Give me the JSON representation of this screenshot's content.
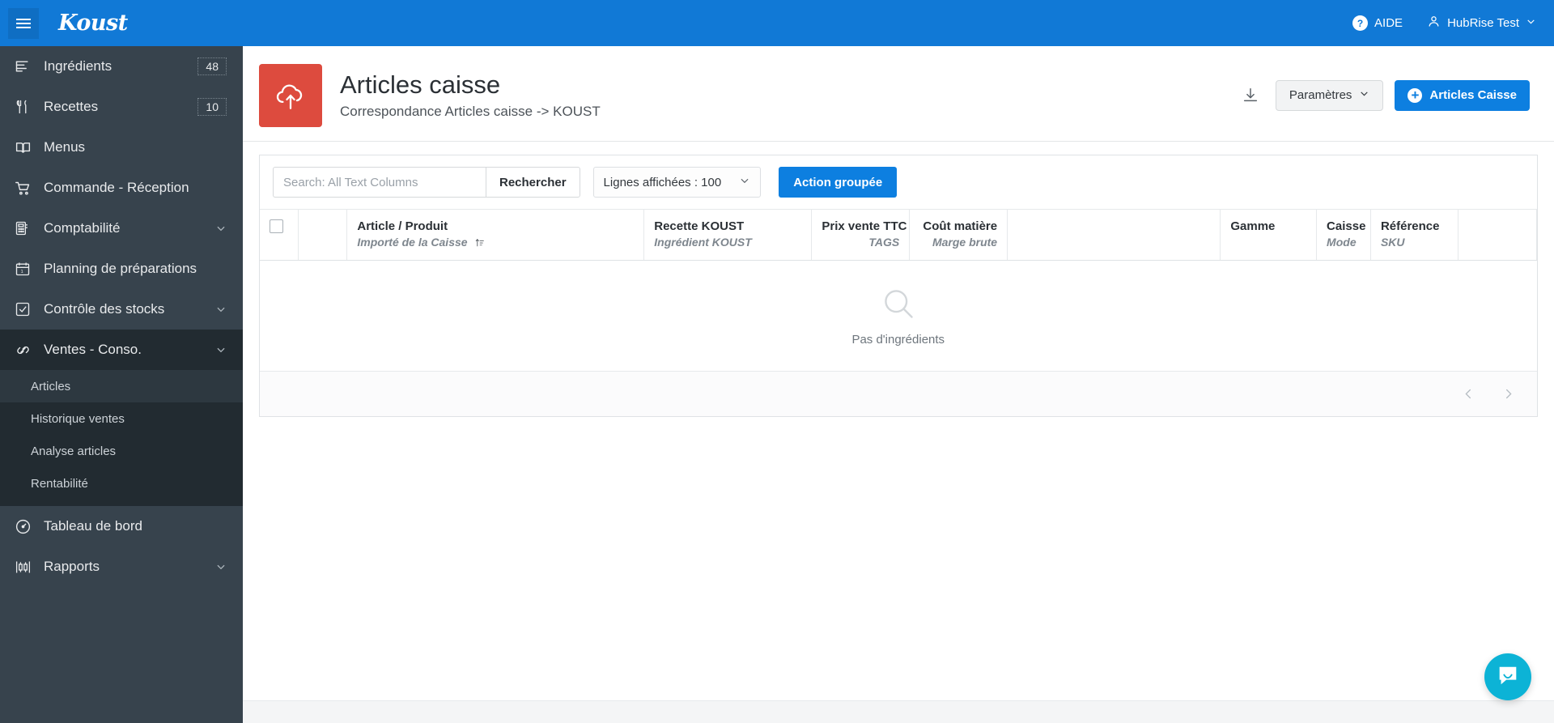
{
  "topbar": {
    "menu_icon": "hamburger-icon",
    "brand": "Koust",
    "help_label": "AIDE",
    "help_icon": "question-circle-icon",
    "user_label": "HubRise Test",
    "user_icon": "person-icon",
    "chevron_icon": "chevron-down-icon",
    "bg_color": "#1179d6"
  },
  "sidebar": {
    "bg_color": "#37434d",
    "items": [
      {
        "label": "Ingrédients",
        "icon": "list-lines-icon",
        "badge": "48",
        "chevron": false
      },
      {
        "label": "Recettes",
        "icon": "fork-knife-icon",
        "badge": "10",
        "chevron": false
      },
      {
        "label": "Menus",
        "icon": "open-book-icon",
        "badge": "",
        "chevron": false
      },
      {
        "label": "Commande - Réception",
        "icon": "shopping-cart-icon",
        "badge": "",
        "chevron": false
      },
      {
        "label": "Comptabilité",
        "icon": "calculator-icon",
        "badge": "",
        "chevron": true
      },
      {
        "label": "Planning de préparations",
        "icon": "calendar-icon",
        "badge": "",
        "chevron": false
      },
      {
        "label": "Contrôle des stocks",
        "icon": "checkbox-checked-icon",
        "badge": "",
        "chevron": true
      }
    ],
    "active_parent": {
      "label": "Ventes - Conso.",
      "icon": "link-chain-icon",
      "chevron": true
    },
    "subitems": [
      {
        "label": "Articles",
        "active": true
      },
      {
        "label": "Historique ventes",
        "active": false
      },
      {
        "label": "Analyse articles",
        "active": false
      },
      {
        "label": "Rentabilité",
        "active": false
      }
    ],
    "items_bottom": [
      {
        "label": "Tableau de bord",
        "icon": "gauge-icon",
        "badge": "",
        "chevron": false
      },
      {
        "label": "Rapports",
        "icon": "bar-chart-icon",
        "badge": "",
        "chevron": true
      }
    ]
  },
  "page": {
    "icon": "cloud-upload-icon",
    "icon_color": "#dd4b3e",
    "title": "Articles caisse",
    "subtitle": "Correspondance Articles caisse -> KOUST",
    "download_icon": "download-icon",
    "settings_label": "Paramètres",
    "settings_chevron": "chevron-down-icon",
    "primary_label": "Articles Caisse",
    "primary_icon": "plus-circle-icon",
    "primary_color": "#0d7fe0"
  },
  "toolbar": {
    "search_placeholder": "Search: All Text Columns",
    "search_value": "",
    "search_button": "Rechercher",
    "rows_label": "Lignes affichées : 100",
    "rows_chevron": "chevron-down-icon",
    "bulk_action": "Action groupée"
  },
  "table": {
    "select_all_icon": "checkbox-icon",
    "columns": [
      {
        "main": "",
        "sub": "",
        "align": "left",
        "sort": false
      },
      {
        "main": "Article / Produit",
        "sub": "Importé de la Caisse",
        "align": "left",
        "sort": true
      },
      {
        "main": "Recette KOUST",
        "sub": "Ingrédient KOUST",
        "align": "left",
        "sort": false
      },
      {
        "main": "Prix vente TTC",
        "sub": "TAGS",
        "align": "right",
        "sort": false
      },
      {
        "main": "Coût matière",
        "sub": "Marge brute",
        "align": "right",
        "sort": false
      },
      {
        "main": "",
        "sub": "",
        "align": "left",
        "sort": false
      },
      {
        "main": "Gamme",
        "sub": "",
        "align": "left",
        "sort": false
      },
      {
        "main": "Caisse",
        "sub": "Mode",
        "align": "left",
        "sort": false
      },
      {
        "main": "Référence",
        "sub": "SKU",
        "align": "left",
        "sort": false
      },
      {
        "main": "",
        "sub": "",
        "align": "left",
        "sort": false
      }
    ],
    "rows": [],
    "empty_icon": "magnifier-icon",
    "empty_text": "Pas d'ingrédients",
    "prev_icon": "chevron-left-icon",
    "next_icon": "chevron-right-icon"
  },
  "chat": {
    "icon": "chat-bubble-icon",
    "color": "#0cb3d6"
  }
}
